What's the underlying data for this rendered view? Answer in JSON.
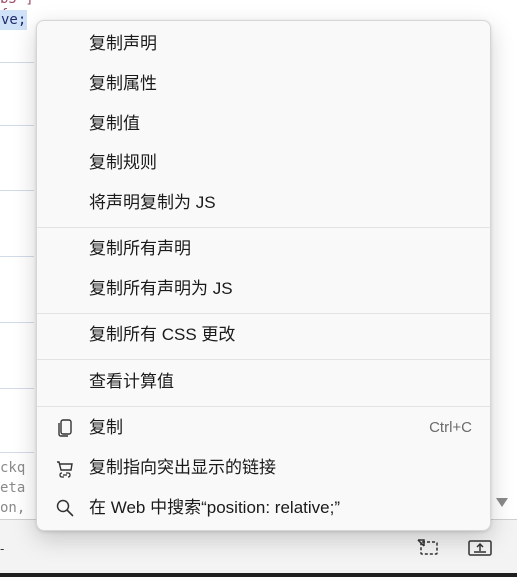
{
  "editor": {
    "top_code_prev": "b5\"] {",
    "selected_code": "ve;",
    "bottom_code": [
      "ckq",
      "eta",
      "on, "
    ]
  },
  "context_menu": {
    "group1": [
      "复制声明",
      "复制属性",
      "复制值",
      "复制规则",
      "将声明复制为 JS"
    ],
    "group2": [
      "复制所有声明",
      "复制所有声明为 JS"
    ],
    "group3": [
      "复制所有 CSS 更改"
    ],
    "group4": [
      "查看计算值"
    ],
    "copy": {
      "label": "复制",
      "shortcut": "Ctrl+C",
      "icon": "copy-icon"
    },
    "copy_link": {
      "label": "复制指向突出显示的链接",
      "icon": "link-copy-icon"
    },
    "search": {
      "label": "在 Web 中搜索“position: relative;”",
      "icon": "search-icon"
    }
  },
  "status_bar": {
    "dash": "-",
    "buttons": [
      "dock-icon",
      "upload-icon"
    ]
  }
}
